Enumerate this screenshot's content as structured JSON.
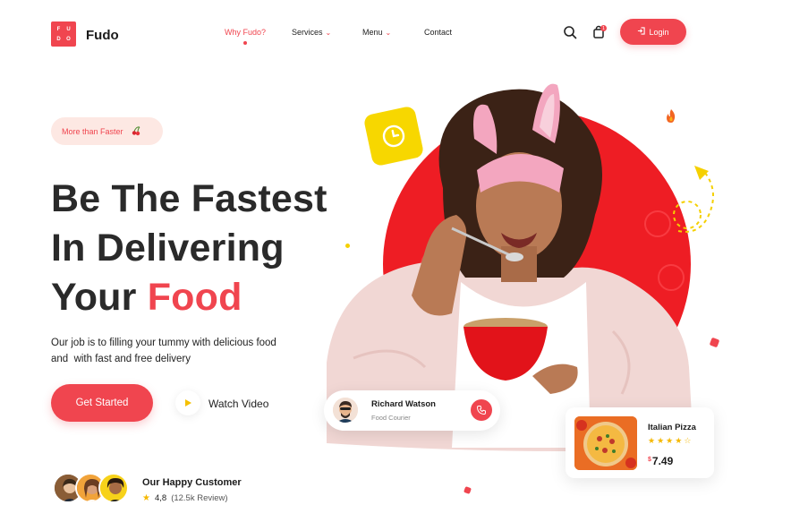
{
  "brand": {
    "logo_letters": [
      "F",
      "U",
      "D",
      "O"
    ],
    "name": "Fudo",
    "accent_color": "#f0454f"
  },
  "nav": {
    "items": [
      {
        "label": "Why Fudo?",
        "active": true,
        "dropdown": false
      },
      {
        "label": "Services",
        "active": false,
        "dropdown": true
      },
      {
        "label": "Menu",
        "active": false,
        "dropdown": true
      },
      {
        "label": "Contact",
        "active": false,
        "dropdown": false
      }
    ],
    "search_icon": "search-icon",
    "cart_icon": "shopping-bag-icon",
    "cart_count": "1",
    "login_label": "Login"
  },
  "hero": {
    "pill_label": "More than Faster",
    "headline_line1": "Be The Fastest",
    "headline_line2": "In Delivering",
    "headline_line3_prefix": "Your",
    "headline_line3_accent": "Food",
    "description_line1": "Our job is to filling your tummy with delicious food",
    "description_line2": "and  with fast and free delivery",
    "cta_label": "Get Started",
    "video_label": "Watch Video"
  },
  "customers": {
    "title": "Our Happy Customer",
    "rating": "4,8",
    "reviews": "(12.5k Review)"
  },
  "courier": {
    "name": "Richard Watson",
    "role": "Food Courier"
  },
  "product": {
    "name": "Italian Pizza",
    "rating_stars": 4,
    "currency": "$",
    "price": "7.49"
  }
}
